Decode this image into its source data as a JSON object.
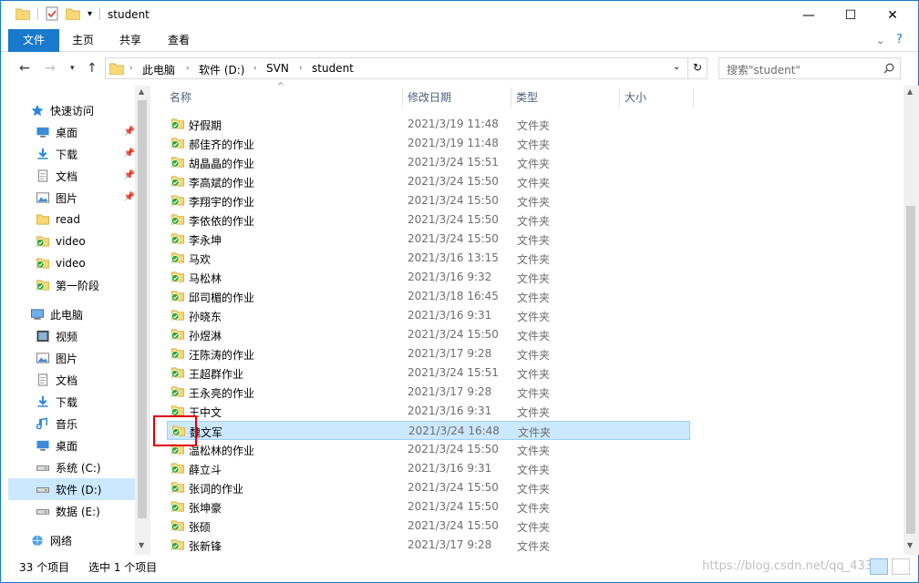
{
  "window": {
    "title": "student"
  },
  "ribbon": {
    "tabs": [
      "文件",
      "主页",
      "共享",
      "查看"
    ]
  },
  "address": {
    "crumbs": [
      "此电脑",
      "软件 (D:)",
      "SVN",
      "student"
    ],
    "search_placeholder": "搜索\"student\""
  },
  "nav": {
    "items": [
      {
        "label": "快速访问",
        "icon": "star-icon"
      },
      {
        "label": "桌面",
        "icon": "desktop-icon",
        "pinned": true
      },
      {
        "label": "下载",
        "icon": "download-icon",
        "pinned": true
      },
      {
        "label": "文档",
        "icon": "document-icon",
        "pinned": true
      },
      {
        "label": "图片",
        "icon": "picture-icon",
        "pinned": true
      },
      {
        "label": "read",
        "icon": "folder-icon"
      },
      {
        "label": "video",
        "icon": "svn-folder-icon"
      },
      {
        "label": "video",
        "icon": "svn-folder-icon"
      },
      {
        "label": "第一阶段",
        "icon": "svn-folder-icon"
      },
      {
        "label": "此电脑",
        "icon": "computer-icon"
      },
      {
        "label": "视频",
        "icon": "video-icon"
      },
      {
        "label": "图片",
        "icon": "picture-icon"
      },
      {
        "label": "文档",
        "icon": "document-icon"
      },
      {
        "label": "下载",
        "icon": "download-icon"
      },
      {
        "label": "音乐",
        "icon": "music-icon"
      },
      {
        "label": "桌面",
        "icon": "desktop-icon"
      },
      {
        "label": "系统 (C:)",
        "icon": "drive-icon"
      },
      {
        "label": "软件 (D:)",
        "icon": "drive-icon",
        "selected": true
      },
      {
        "label": "数据 (E:)",
        "icon": "drive-icon"
      },
      {
        "label": "网络",
        "icon": "network-icon"
      }
    ]
  },
  "columns": [
    "名称",
    "修改日期",
    "类型",
    "大小"
  ],
  "files": [
    {
      "name": "好假期",
      "date": "2021/3/19 11:48",
      "type": "文件夹"
    },
    {
      "name": "郝佳齐的作业",
      "date": "2021/3/19 11:48",
      "type": "文件夹"
    },
    {
      "name": "胡晶晶的作业",
      "date": "2021/3/24 15:51",
      "type": "文件夹"
    },
    {
      "name": "李高斌的作业",
      "date": "2021/3/24 15:50",
      "type": "文件夹"
    },
    {
      "name": "李翔宇的作业",
      "date": "2021/3/24 15:50",
      "type": "文件夹"
    },
    {
      "name": "李依依的作业",
      "date": "2021/3/24 15:50",
      "type": "文件夹"
    },
    {
      "name": "李永坤",
      "date": "2021/3/24 15:50",
      "type": "文件夹"
    },
    {
      "name": "马欢",
      "date": "2021/3/16 13:15",
      "type": "文件夹"
    },
    {
      "name": "马松林",
      "date": "2021/3/16 9:32",
      "type": "文件夹"
    },
    {
      "name": "邱司楣的作业",
      "date": "2021/3/18 16:45",
      "type": "文件夹"
    },
    {
      "name": "孙晓东",
      "date": "2021/3/16 9:31",
      "type": "文件夹"
    },
    {
      "name": "孙煜淋",
      "date": "2021/3/24 15:50",
      "type": "文件夹"
    },
    {
      "name": "汪陈涛的作业",
      "date": "2021/3/17 9:28",
      "type": "文件夹"
    },
    {
      "name": "王超群作业",
      "date": "2021/3/24 15:51",
      "type": "文件夹"
    },
    {
      "name": "王永亮的作业",
      "date": "2021/3/17 9:28",
      "type": "文件夹"
    },
    {
      "name": "王中文",
      "date": "2021/3/16 9:31",
      "type": "文件夹"
    },
    {
      "name": "魏文军",
      "date": "2021/3/24 16:48",
      "type": "文件夹",
      "selected": true
    },
    {
      "name": "温松林的作业",
      "date": "2021/3/24 15:50",
      "type": "文件夹"
    },
    {
      "name": "薛立斗",
      "date": "2021/3/16 9:31",
      "type": "文件夹"
    },
    {
      "name": "张词的作业",
      "date": "2021/3/24 15:50",
      "type": "文件夹"
    },
    {
      "name": "张坤豪",
      "date": "2021/3/24 15:50",
      "type": "文件夹"
    },
    {
      "name": "张硕",
      "date": "2021/3/24 15:50",
      "type": "文件夹"
    },
    {
      "name": "张新锋",
      "date": "2021/3/17 9:28",
      "type": "文件夹"
    }
  ],
  "status": {
    "count": "33 个项目",
    "selection": "选中 1 个项目",
    "watermark": "https://blog.csdn.net/qq_433"
  },
  "colors": {
    "accent": "#1979ca",
    "selection": "#cce8ff",
    "svn_ok": "#2aa52a",
    "folder": "#f8d775"
  }
}
